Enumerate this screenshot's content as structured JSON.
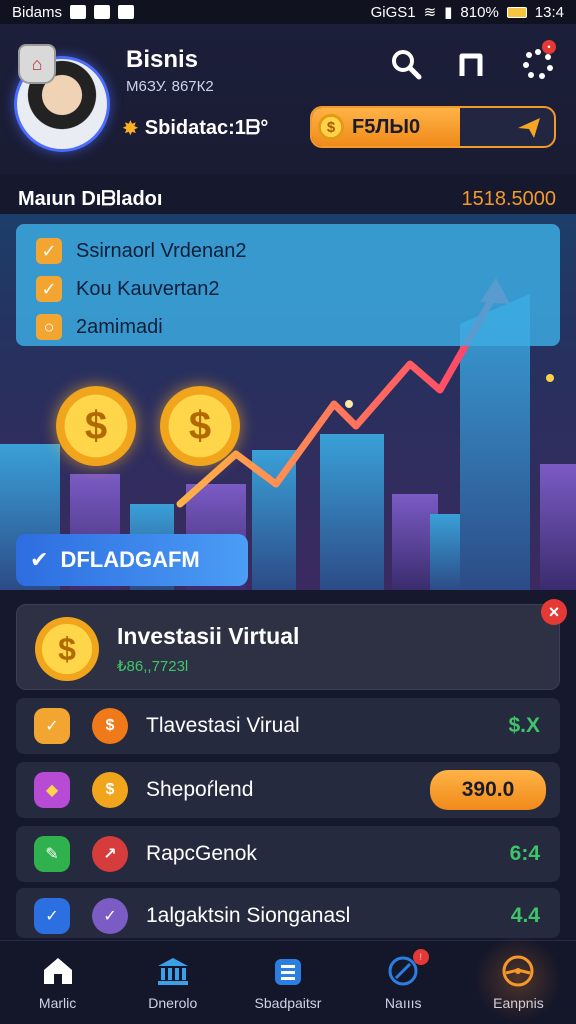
{
  "status_bar": {
    "carrier": "Bidams",
    "network": "GiGS1",
    "battery_text": "810%",
    "time": "13:4"
  },
  "profile": {
    "name": "Bisnis",
    "id": "M6ЗУ. 867К2",
    "points": "Sbidatac:1ᗷ°"
  },
  "balance": {
    "label": "F5ЛЫ0",
    "fill_fraction": 0.61
  },
  "section": {
    "title": "Maıun Dıᗷladoı",
    "amount": "1518.5000"
  },
  "tasks": [
    {
      "label": "Ssirnaorl Vrdenan2"
    },
    {
      "label": "Kou Kauvertan2"
    },
    {
      "label": "2amimadi"
    }
  ],
  "hero_button": {
    "label": "DFLADGAFM"
  },
  "featured": {
    "title": "Investasii Virtual",
    "subtitle": "₺86,,7723l"
  },
  "list": [
    {
      "label": "Tlavestasi Virual",
      "value": "$.X",
      "value_color": "#3fc46a",
      "icon1": "check-icon",
      "icon2": "coin-icon"
    },
    {
      "label": "Shepoŕlend",
      "value": "390.0",
      "value_color": "#1b1b2e",
      "icon1": "gem-icon",
      "icon2": "coin-icon"
    },
    {
      "label": "RapcGenok",
      "value": "6:4",
      "value_color": "#3fc46a",
      "icon1": "leaf-icon",
      "icon2": "arrow-icon"
    },
    {
      "label": "1algaktsin Sionganasl",
      "value": "4.4",
      "value_color": "#3fc46a",
      "icon1": "shield-icon",
      "icon2": "shield-check-icon"
    }
  ],
  "nav": [
    {
      "label": "Marlic",
      "icon": "home-icon"
    },
    {
      "label": "Dnerolo",
      "icon": "bank-icon"
    },
    {
      "label": "Sbadpaitsr",
      "icon": "wallet-icon"
    },
    {
      "label": "Naıııs",
      "icon": "notification-icon",
      "badge": "!"
    },
    {
      "label": "Eanpnis",
      "icon": "steering-icon"
    }
  ],
  "colors": {
    "accent_orange": "#f29b2a",
    "accent_blue": "#2d6de0",
    "positive_green": "#3fc46a",
    "alert_red": "#e53935"
  }
}
